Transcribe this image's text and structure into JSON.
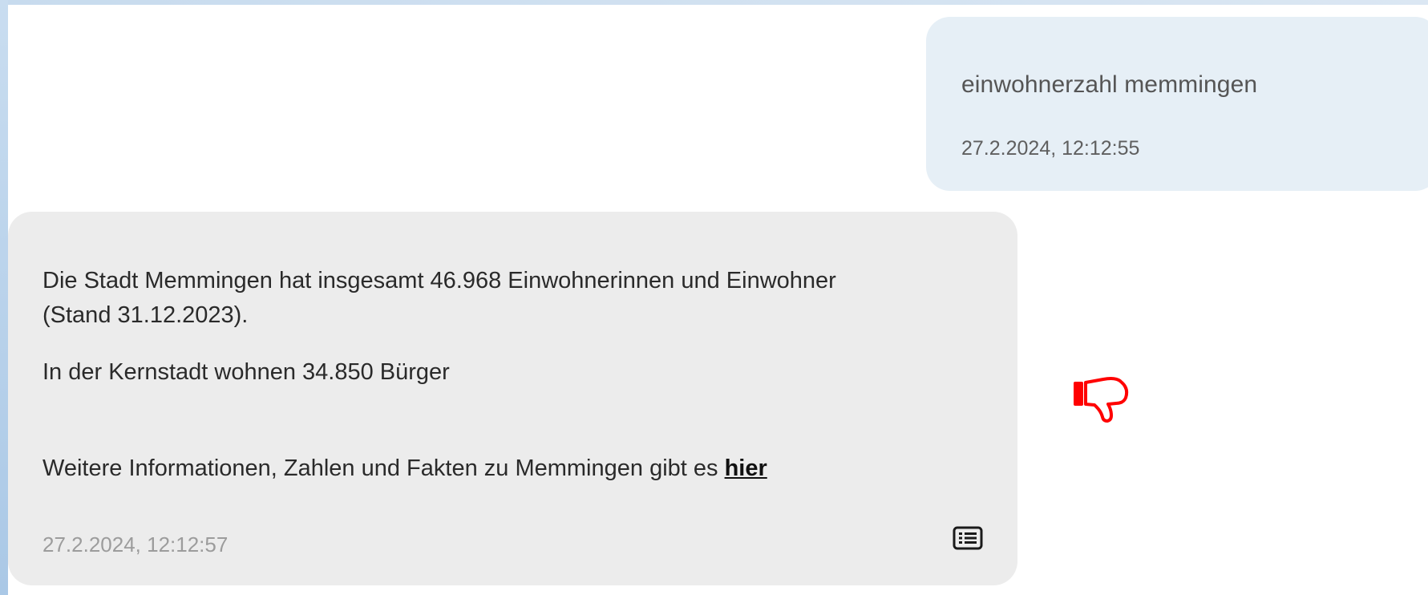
{
  "chat": {
    "user_message": {
      "text": "einwohnerzahl memmingen",
      "timestamp": "27.2.2024, 12:12:55"
    },
    "bot_message": {
      "line1": "Die Stadt Memmingen hat insgesamt 46.968 Einwohnerinnen und Einwohner",
      "line2": "(Stand 31.12.2023).",
      "line3": "In der Kernstadt wohnen 34.850 Bürger",
      "line4_prefix": "Weitere Informationen, Zahlen und Fakten zu Memmingen gibt es ",
      "link_text": "hier",
      "timestamp": "27.2.2024, 12:12:57",
      "source_icon": "list-icon"
    },
    "feedback": {
      "icon": "thumbs-down-icon",
      "color": "#ff0000"
    }
  },
  "colors": {
    "user_bubble": "#e6eff6",
    "bot_bubble": "#ececec",
    "frame": "#c9ddf0"
  }
}
